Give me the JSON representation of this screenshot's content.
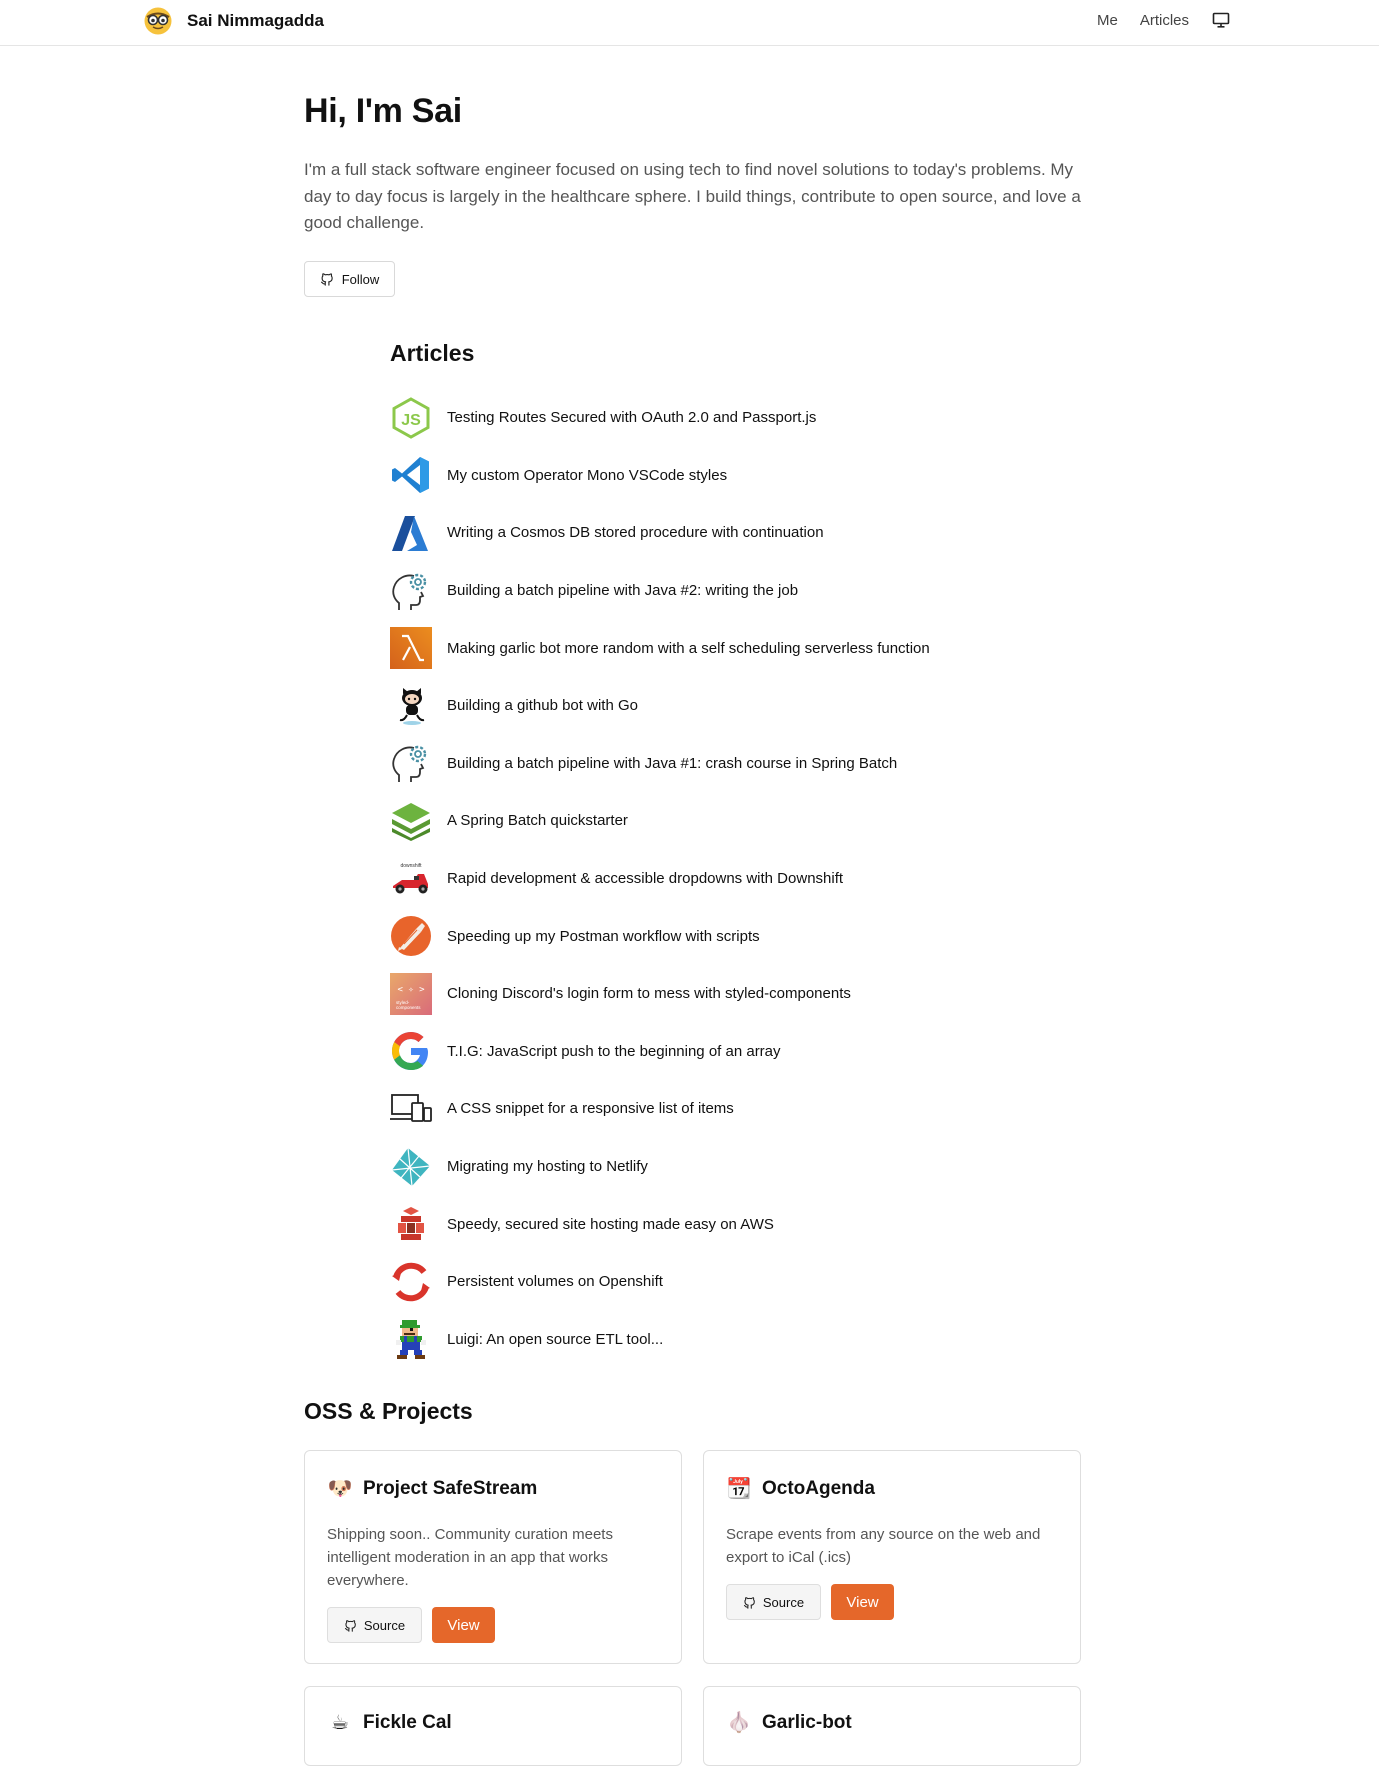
{
  "header": {
    "site_name": "Sai Nimmagadda",
    "nav": [
      "Me",
      "Articles"
    ],
    "theme_icon": "monitor-icon"
  },
  "hero": {
    "greeting": "Hi, I'm Sai",
    "bio": "I'm a full stack software engineer focused on using tech to find novel solutions to today's problems. My day to day focus is largely in the healthcare sphere. I build things, contribute to open source, and love a good challenge.",
    "follow_label": "Follow"
  },
  "articles": {
    "heading": "Articles",
    "items": [
      {
        "title": "Testing Routes Secured with OAuth 2.0 and Passport.js",
        "icon": "nodejs-icon"
      },
      {
        "title": "My custom Operator Mono VSCode styles",
        "icon": "vscode-icon"
      },
      {
        "title": "Writing a Cosmos DB stored procedure with continuation",
        "icon": "azure-icon"
      },
      {
        "title": "Building a batch pipeline with Java #2: writing the job",
        "icon": "head-gear-icon"
      },
      {
        "title": "Making garlic bot more random with a self scheduling serverless function",
        "icon": "aws-lambda-icon"
      },
      {
        "title": "Building a github bot with Go",
        "icon": "octocat-icon"
      },
      {
        "title": "Building a batch pipeline with Java #1: crash course in Spring Batch",
        "icon": "head-gear-icon"
      },
      {
        "title": "A Spring Batch quickstarter",
        "icon": "spring-batch-icon"
      },
      {
        "title": "Rapid development & accessible dropdowns with Downshift",
        "icon": "downshift-icon"
      },
      {
        "title": "Speeding up my Postman workflow with scripts",
        "icon": "postman-icon"
      },
      {
        "title": "Cloning Discord's login form to mess with styled-components",
        "icon": "styled-components-icon"
      },
      {
        "title": "T.I.G: JavaScript push to the beginning of an array",
        "icon": "google-icon"
      },
      {
        "title": "A CSS snippet for a responsive list of items",
        "icon": "responsive-devices-icon"
      },
      {
        "title": "Migrating my hosting to Netlify",
        "icon": "netlify-icon"
      },
      {
        "title": "Speedy, secured site hosting made easy on AWS",
        "icon": "aws-icon"
      },
      {
        "title": "Persistent volumes on Openshift",
        "icon": "openshift-icon"
      },
      {
        "title": "Luigi: An open source ETL tool...",
        "icon": "luigi-icon"
      }
    ]
  },
  "oss": {
    "heading": "OSS & Projects",
    "source_label": "Source",
    "view_label": "View",
    "accent": "#e5672a",
    "projects": [
      {
        "emoji": "🐶",
        "name": "Project SafeStream",
        "description": "Shipping soon.. Community curation meets intelligent moderation in an app that works everywhere."
      },
      {
        "emoji": "📆",
        "name": "OctoAgenda",
        "description": "Scrape events from any source on the web and export to iCal (.ics)"
      },
      {
        "emoji": "☕",
        "name": "Fickle Cal",
        "description": ""
      },
      {
        "emoji": "🧄",
        "name": "Garlic-bot",
        "description": ""
      }
    ]
  }
}
